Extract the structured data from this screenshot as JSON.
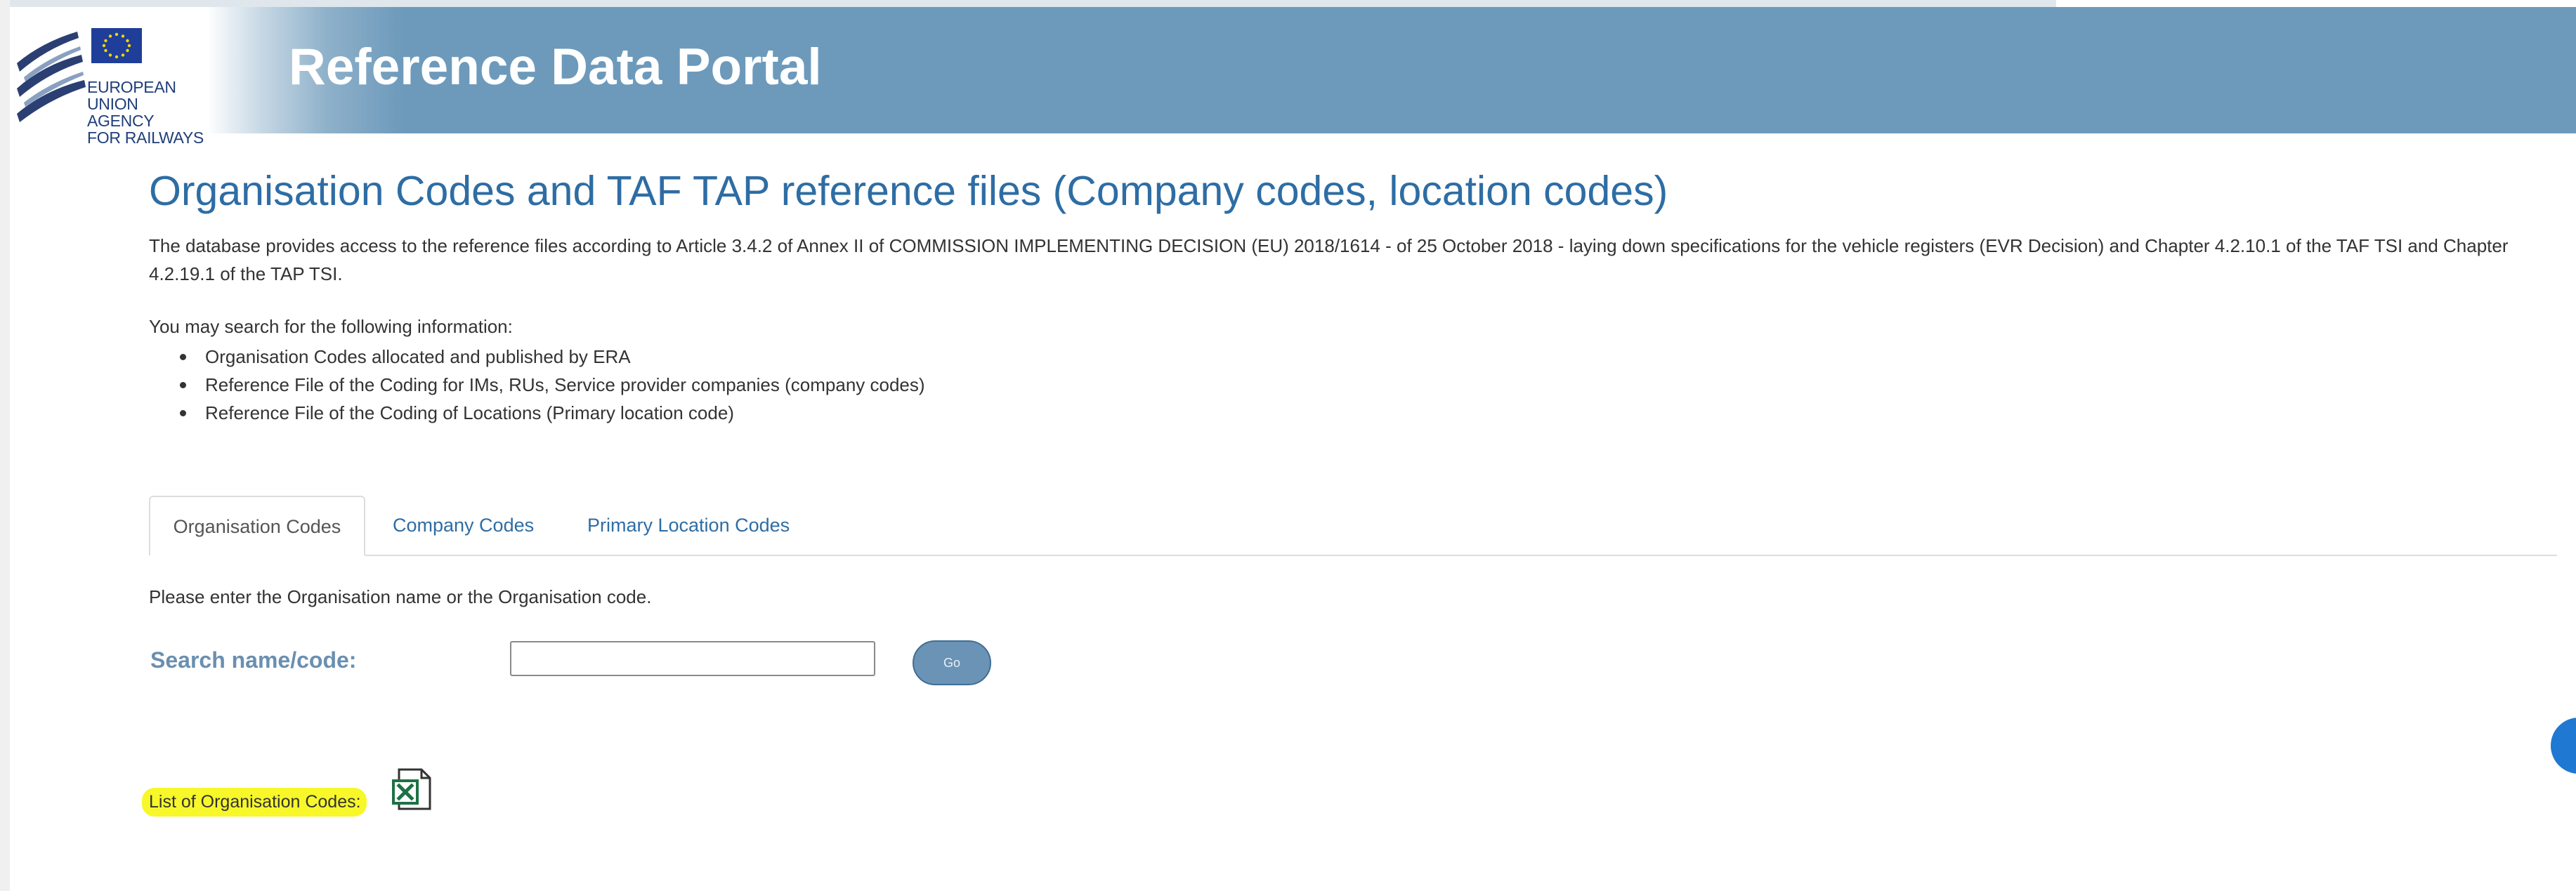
{
  "header": {
    "logo_lines": [
      "EUROPEAN",
      "UNION",
      "AGENCY",
      "FOR RAILWAYS"
    ],
    "title": "Reference Data Portal"
  },
  "main": {
    "page_title": "Organisation Codes and TAF TAP reference files (Company codes, location codes)",
    "intro": "The database provides access to the reference files according to Article 3.4.2 of Annex II of COMMISSION IMPLEMENTING DECISION (EU) 2018/1614 - of 25 October 2018 - laying down specifications for the vehicle registers (EVR Decision) and Chapter 4.2.10.1 of the TAF TSI and Chapter 4.2.19.1 of the TAP TSI.",
    "may_search": "You may search for the following information:",
    "info_items": [
      "Organisation Codes allocated and published by ERA",
      "Reference File of the Coding for IMs, RUs, Service provider companies (company codes)",
      "Reference File of the Coding of Locations (Primary location code)"
    ],
    "tabs": [
      {
        "label": "Organisation Codes",
        "active": true
      },
      {
        "label": "Company Codes",
        "active": false
      },
      {
        "label": "Primary Location Codes",
        "active": false
      }
    ],
    "enter_text": "Please enter the Organisation name or the Organisation code.",
    "search": {
      "label": "Search name/code:",
      "value": "",
      "placeholder": "",
      "go_label": "Go"
    },
    "list_label": "List of Organisation Codes:",
    "list_icon": "excel-file-icon"
  },
  "colors": {
    "header_blue": "#6d9abb",
    "title_blue": "#2e6da4",
    "highlight": "#f7f72a",
    "excel_green": "#1e7145"
  }
}
